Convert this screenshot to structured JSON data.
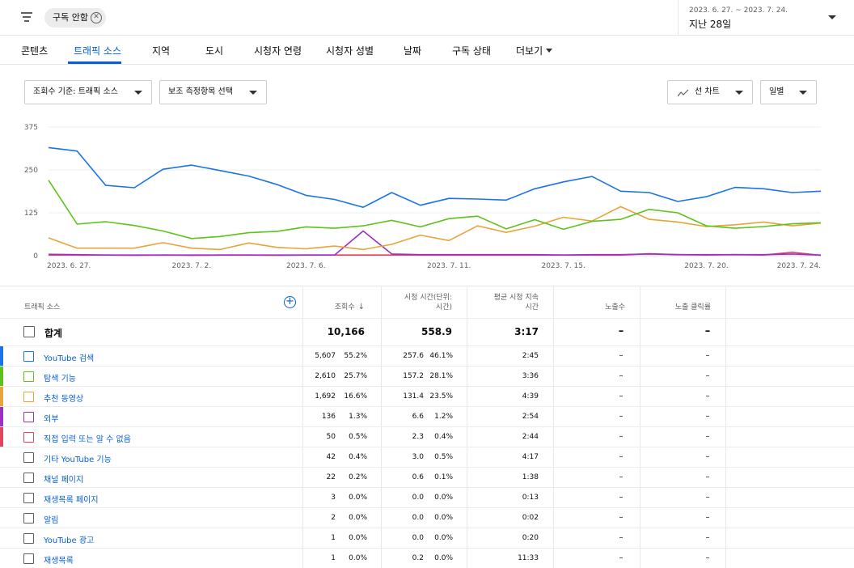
{
  "filter": {
    "chip_label": "구독 안함",
    "date_range": "2023. 6. 27. ~ 2023. 7. 24.",
    "period_label": "지난 28일"
  },
  "tabs": [
    {
      "label": "콘텐츠",
      "active": false
    },
    {
      "label": "트래픽 소스",
      "active": true
    },
    {
      "label": "지역",
      "active": false
    },
    {
      "label": "도시",
      "active": false
    },
    {
      "label": "시청자 연령",
      "active": false
    },
    {
      "label": "시청자 성별",
      "active": false
    },
    {
      "label": "날짜",
      "active": false
    },
    {
      "label": "구독 상태",
      "active": false
    },
    {
      "label": "더보기",
      "active": false
    }
  ],
  "controls": {
    "metric_dropdown": "조회수 기준: 트래픽 소스",
    "secondary_dropdown": "보조 측정항목 선택",
    "chart_type_dropdown": "선 차트",
    "interval_dropdown": "일별"
  },
  "chart_data": {
    "type": "line",
    "yticks": [
      "375",
      "250",
      "125",
      "0"
    ],
    "ylim": [
      0,
      375
    ],
    "x_labels": [
      {
        "index": 0,
        "label": "2023. 6. 27."
      },
      {
        "index": 5,
        "label": "2023. 7. 2."
      },
      {
        "index": 9,
        "label": "2023. 7. 6."
      },
      {
        "index": 14,
        "label": "2023. 7. 11."
      },
      {
        "index": 18,
        "label": "2023. 7. 15."
      },
      {
        "index": 23,
        "label": "2023. 7. 20."
      },
      {
        "index": 27,
        "label": "2023. 7. 24."
      }
    ],
    "grid": true,
    "series": [
      {
        "color": "#1a73e8",
        "values": [
          315,
          305,
          205,
          198,
          252,
          264,
          248,
          232,
          207,
          176,
          164,
          141,
          184,
          147,
          167,
          165,
          162,
          195,
          215,
          231,
          188,
          184,
          158,
          172,
          199,
          195,
          184,
          188
        ]
      },
      {
        "color": "#5ec21c",
        "values": [
          220,
          92,
          99,
          88,
          72,
          50,
          56,
          67,
          71,
          84,
          80,
          87,
          103,
          84,
          108,
          115,
          78,
          105,
          77,
          100,
          106,
          135,
          125,
          87,
          80,
          85,
          93,
          96
        ]
      },
      {
        "color": "#e8a33a",
        "values": [
          52,
          22,
          22,
          22,
          38,
          22,
          18,
          37,
          24,
          20,
          28,
          18,
          33,
          60,
          44,
          87,
          68,
          86,
          112,
          101,
          143,
          106,
          98,
          85,
          90,
          98,
          87,
          95
        ]
      },
      {
        "color": "#9b2fc6",
        "values": [
          4,
          3,
          2,
          2,
          2,
          2,
          2,
          2,
          2,
          2,
          2,
          72,
          5,
          3,
          3,
          3,
          3,
          3,
          2,
          3,
          3,
          5,
          3,
          3,
          3,
          3,
          5,
          2
        ]
      },
      {
        "color": "#e0455e",
        "values": [
          2,
          2,
          2,
          1,
          2,
          1,
          2,
          2,
          1,
          2,
          2,
          2,
          2,
          2,
          2,
          2,
          2,
          2,
          2,
          2,
          2,
          6,
          3,
          2,
          3,
          2,
          10,
          1
        ]
      }
    ]
  },
  "table": {
    "headers": {
      "source": "트래픽 소스",
      "views": "조회수",
      "sort_arrow": "↓",
      "watch_time_line1": "시청 시간(단위:",
      "watch_time_line2": "시간)",
      "avg_duration_line1": "평균 시청 지속",
      "avg_duration_line2": "시간",
      "impressions": "노출수",
      "ctr": "노출 클릭률"
    },
    "total": {
      "name": "합계",
      "views": "10,166",
      "watch": "558.9",
      "avg": "3:17",
      "impressions": "–",
      "ctr": "–"
    },
    "rows": [
      {
        "name": "YouTube 검색",
        "color": "#1a73e8",
        "views": "5,607",
        "views_pct": "55.2%",
        "watch": "257.6",
        "watch_pct": "46.1%",
        "avg": "2:45",
        "impressions": "–",
        "ctr": "–"
      },
      {
        "name": "탐색 기능",
        "color": "#5ec21c",
        "views": "2,610",
        "views_pct": "25.7%",
        "watch": "157.2",
        "watch_pct": "28.1%",
        "avg": "3:36",
        "impressions": "–",
        "ctr": "–"
      },
      {
        "name": "추천 동영상",
        "color": "#e8a33a",
        "views": "1,692",
        "views_pct": "16.6%",
        "watch": "131.4",
        "watch_pct": "23.5%",
        "avg": "4:39",
        "impressions": "–",
        "ctr": "–"
      },
      {
        "name": "외부",
        "color": "#9b2fc6",
        "views": "136",
        "views_pct": "1.3%",
        "watch": "6.6",
        "watch_pct": "1.2%",
        "avg": "2:54",
        "impressions": "–",
        "ctr": "–"
      },
      {
        "name": "직접 입력 또는 알 수 없음",
        "color": "#e0455e",
        "views": "50",
        "views_pct": "0.5%",
        "watch": "2.3",
        "watch_pct": "0.4%",
        "avg": "2:44",
        "impressions": "–",
        "ctr": "–"
      },
      {
        "name": "기타 YouTube 기능",
        "color": "",
        "views": "42",
        "views_pct": "0.4%",
        "watch": "3.0",
        "watch_pct": "0.5%",
        "avg": "4:17",
        "impressions": "–",
        "ctr": "–"
      },
      {
        "name": "채널 페이지",
        "color": "",
        "views": "22",
        "views_pct": "0.2%",
        "watch": "0.6",
        "watch_pct": "0.1%",
        "avg": "1:38",
        "impressions": "–",
        "ctr": "–"
      },
      {
        "name": "재생목록 페이지",
        "color": "",
        "views": "3",
        "views_pct": "0.0%",
        "watch": "0.0",
        "watch_pct": "0.0%",
        "avg": "0:13",
        "impressions": "–",
        "ctr": "–"
      },
      {
        "name": "알림",
        "color": "",
        "views": "2",
        "views_pct": "0.0%",
        "watch": "0.0",
        "watch_pct": "0.0%",
        "avg": "0:02",
        "impressions": "–",
        "ctr": "–"
      },
      {
        "name": "YouTube 광고",
        "color": "",
        "views": "1",
        "views_pct": "0.0%",
        "watch": "0.0",
        "watch_pct": "0.0%",
        "avg": "0:20",
        "impressions": "–",
        "ctr": "–"
      },
      {
        "name": "재생목록",
        "color": "",
        "views": "1",
        "views_pct": "0.0%",
        "watch": "0.2",
        "watch_pct": "0.0%",
        "avg": "11:33",
        "impressions": "–",
        "ctr": "–"
      }
    ]
  }
}
